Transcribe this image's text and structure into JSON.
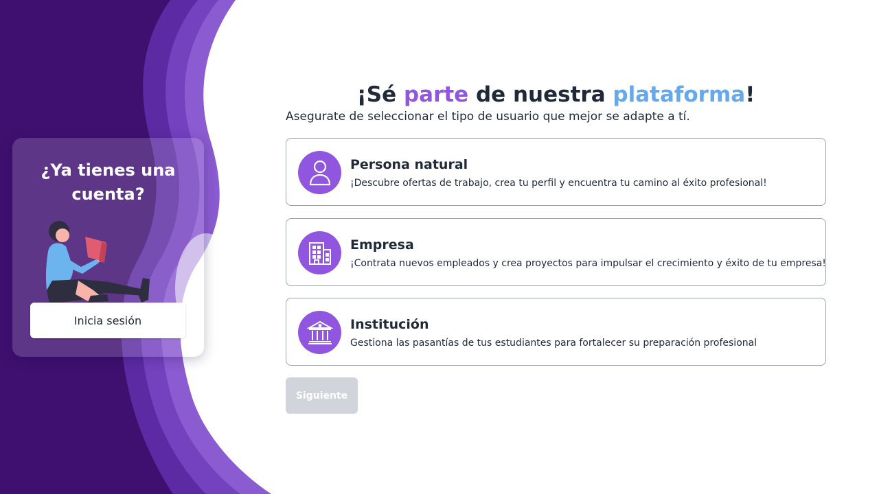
{
  "colors": {
    "accent_purple": "#9056e0",
    "accent_blue": "#64a8ee",
    "dark_purple": "#3f1070",
    "disabled_gray": "#d1d5db"
  },
  "login_card": {
    "title": "¿Ya tienes una cuenta?",
    "button_label": "Inicia sesión"
  },
  "header": {
    "title_parts": {
      "p1": "¡Sé ",
      "p2": "parte",
      "p3": " de nuestra ",
      "p4": "plataforma",
      "p5": "!"
    },
    "subtitle": "Asegurate de seleccionar el tipo de usuario que mejor se adapte a tí."
  },
  "options": [
    {
      "icon": "user-icon",
      "title": "Persona natural",
      "description": "¡Descubre ofertas de trabajo, crea tu perfil y encuentra tu camino al éxito profesional!"
    },
    {
      "icon": "building-icon",
      "title": "Empresa",
      "description": "¡Contrata nuevos empleados y crea proyectos para impulsar el crecimiento y éxito de tu empresa!"
    },
    {
      "icon": "institution-icon",
      "title": "Institución",
      "description": "Gestiona las pasantías de tus estudiantes para fortalecer su preparación profesional"
    }
  ],
  "next_button": {
    "label": "Siguiente",
    "state": "disabled"
  }
}
